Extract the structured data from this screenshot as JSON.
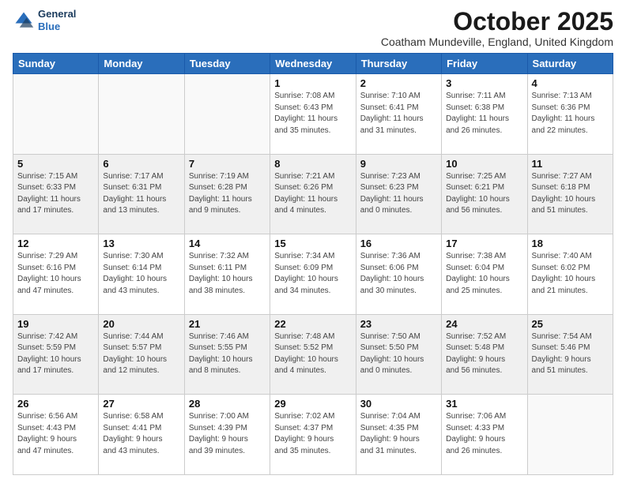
{
  "header": {
    "logo_line1": "General",
    "logo_line2": "Blue",
    "month": "October 2025",
    "location": "Coatham Mundeville, England, United Kingdom"
  },
  "days_of_week": [
    "Sunday",
    "Monday",
    "Tuesday",
    "Wednesday",
    "Thursday",
    "Friday",
    "Saturday"
  ],
  "weeks": [
    [
      {
        "day": "",
        "info": ""
      },
      {
        "day": "",
        "info": ""
      },
      {
        "day": "",
        "info": ""
      },
      {
        "day": "1",
        "info": "Sunrise: 7:08 AM\nSunset: 6:43 PM\nDaylight: 11 hours\nand 35 minutes."
      },
      {
        "day": "2",
        "info": "Sunrise: 7:10 AM\nSunset: 6:41 PM\nDaylight: 11 hours\nand 31 minutes."
      },
      {
        "day": "3",
        "info": "Sunrise: 7:11 AM\nSunset: 6:38 PM\nDaylight: 11 hours\nand 26 minutes."
      },
      {
        "day": "4",
        "info": "Sunrise: 7:13 AM\nSunset: 6:36 PM\nDaylight: 11 hours\nand 22 minutes."
      }
    ],
    [
      {
        "day": "5",
        "info": "Sunrise: 7:15 AM\nSunset: 6:33 PM\nDaylight: 11 hours\nand 17 minutes."
      },
      {
        "day": "6",
        "info": "Sunrise: 7:17 AM\nSunset: 6:31 PM\nDaylight: 11 hours\nand 13 minutes."
      },
      {
        "day": "7",
        "info": "Sunrise: 7:19 AM\nSunset: 6:28 PM\nDaylight: 11 hours\nand 9 minutes."
      },
      {
        "day": "8",
        "info": "Sunrise: 7:21 AM\nSunset: 6:26 PM\nDaylight: 11 hours\nand 4 minutes."
      },
      {
        "day": "9",
        "info": "Sunrise: 7:23 AM\nSunset: 6:23 PM\nDaylight: 11 hours\nand 0 minutes."
      },
      {
        "day": "10",
        "info": "Sunrise: 7:25 AM\nSunset: 6:21 PM\nDaylight: 10 hours\nand 56 minutes."
      },
      {
        "day": "11",
        "info": "Sunrise: 7:27 AM\nSunset: 6:18 PM\nDaylight: 10 hours\nand 51 minutes."
      }
    ],
    [
      {
        "day": "12",
        "info": "Sunrise: 7:29 AM\nSunset: 6:16 PM\nDaylight: 10 hours\nand 47 minutes."
      },
      {
        "day": "13",
        "info": "Sunrise: 7:30 AM\nSunset: 6:14 PM\nDaylight: 10 hours\nand 43 minutes."
      },
      {
        "day": "14",
        "info": "Sunrise: 7:32 AM\nSunset: 6:11 PM\nDaylight: 10 hours\nand 38 minutes."
      },
      {
        "day": "15",
        "info": "Sunrise: 7:34 AM\nSunset: 6:09 PM\nDaylight: 10 hours\nand 34 minutes."
      },
      {
        "day": "16",
        "info": "Sunrise: 7:36 AM\nSunset: 6:06 PM\nDaylight: 10 hours\nand 30 minutes."
      },
      {
        "day": "17",
        "info": "Sunrise: 7:38 AM\nSunset: 6:04 PM\nDaylight: 10 hours\nand 25 minutes."
      },
      {
        "day": "18",
        "info": "Sunrise: 7:40 AM\nSunset: 6:02 PM\nDaylight: 10 hours\nand 21 minutes."
      }
    ],
    [
      {
        "day": "19",
        "info": "Sunrise: 7:42 AM\nSunset: 5:59 PM\nDaylight: 10 hours\nand 17 minutes."
      },
      {
        "day": "20",
        "info": "Sunrise: 7:44 AM\nSunset: 5:57 PM\nDaylight: 10 hours\nand 12 minutes."
      },
      {
        "day": "21",
        "info": "Sunrise: 7:46 AM\nSunset: 5:55 PM\nDaylight: 10 hours\nand 8 minutes."
      },
      {
        "day": "22",
        "info": "Sunrise: 7:48 AM\nSunset: 5:52 PM\nDaylight: 10 hours\nand 4 minutes."
      },
      {
        "day": "23",
        "info": "Sunrise: 7:50 AM\nSunset: 5:50 PM\nDaylight: 10 hours\nand 0 minutes."
      },
      {
        "day": "24",
        "info": "Sunrise: 7:52 AM\nSunset: 5:48 PM\nDaylight: 9 hours\nand 56 minutes."
      },
      {
        "day": "25",
        "info": "Sunrise: 7:54 AM\nSunset: 5:46 PM\nDaylight: 9 hours\nand 51 minutes."
      }
    ],
    [
      {
        "day": "26",
        "info": "Sunrise: 6:56 AM\nSunset: 4:43 PM\nDaylight: 9 hours\nand 47 minutes."
      },
      {
        "day": "27",
        "info": "Sunrise: 6:58 AM\nSunset: 4:41 PM\nDaylight: 9 hours\nand 43 minutes."
      },
      {
        "day": "28",
        "info": "Sunrise: 7:00 AM\nSunset: 4:39 PM\nDaylight: 9 hours\nand 39 minutes."
      },
      {
        "day": "29",
        "info": "Sunrise: 7:02 AM\nSunset: 4:37 PM\nDaylight: 9 hours\nand 35 minutes."
      },
      {
        "day": "30",
        "info": "Sunrise: 7:04 AM\nSunset: 4:35 PM\nDaylight: 9 hours\nand 31 minutes."
      },
      {
        "day": "31",
        "info": "Sunrise: 7:06 AM\nSunset: 4:33 PM\nDaylight: 9 hours\nand 26 minutes."
      },
      {
        "day": "",
        "info": ""
      }
    ]
  ]
}
